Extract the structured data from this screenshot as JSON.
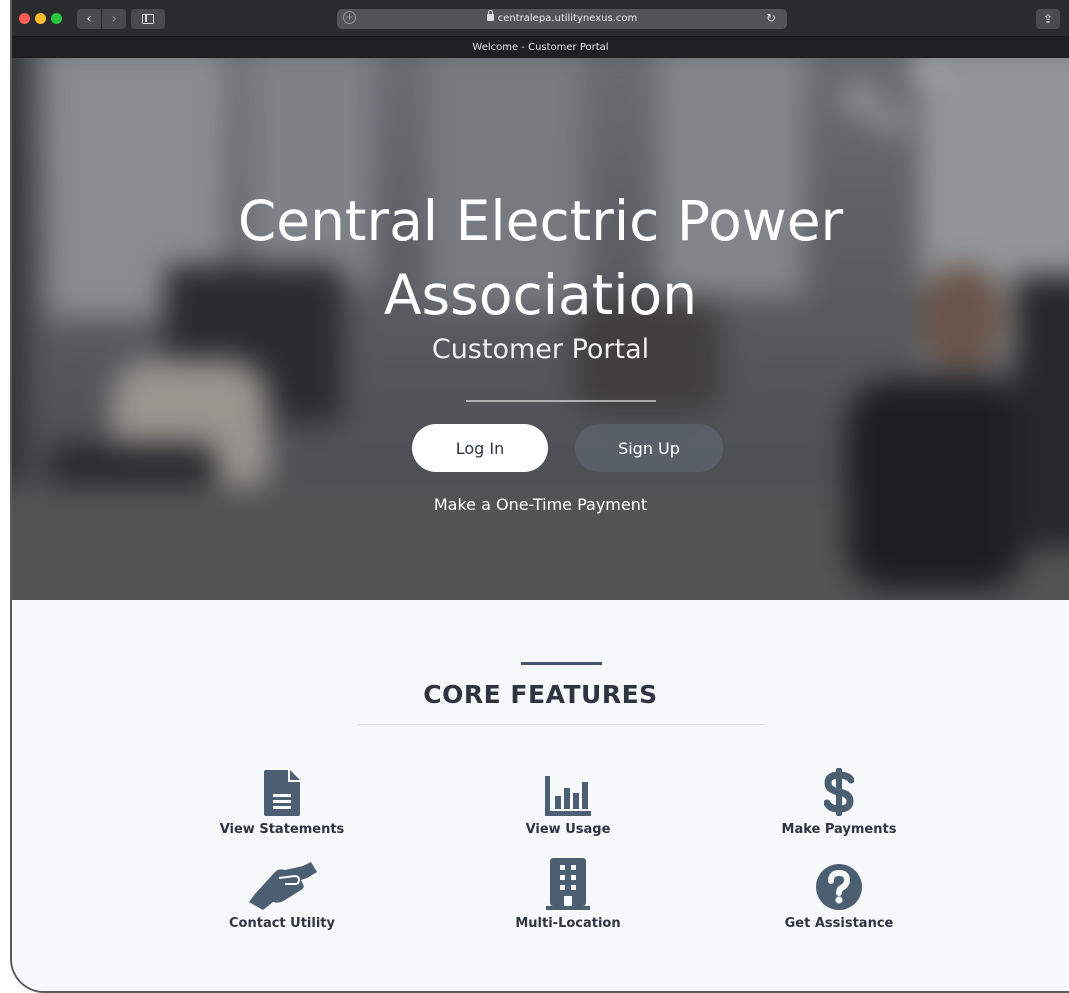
{
  "browser": {
    "address": "centralepa.utilitynexus.com",
    "tab_title": "Welcome - Customer Portal"
  },
  "hero": {
    "title_line1": "Central Electric Power",
    "title_line2": "Association",
    "subtitle": "Customer Portal",
    "login_label": "Log In",
    "signup_label": "Sign Up",
    "one_time_payment_label": "Make a One-Time Payment"
  },
  "features": {
    "heading": "CORE FEATURES",
    "items": [
      {
        "label": "View Statements",
        "icon": "document-icon"
      },
      {
        "label": "View Usage",
        "icon": "bar-chart-icon"
      },
      {
        "label": "Make Payments",
        "icon": "dollar-icon"
      },
      {
        "label": "Contact Utility",
        "icon": "handshake-icon"
      },
      {
        "label": "Multi-Location",
        "icon": "building-icon"
      },
      {
        "label": "Get Assistance",
        "icon": "question-icon"
      }
    ],
    "icon_color": "#4b5e72"
  }
}
